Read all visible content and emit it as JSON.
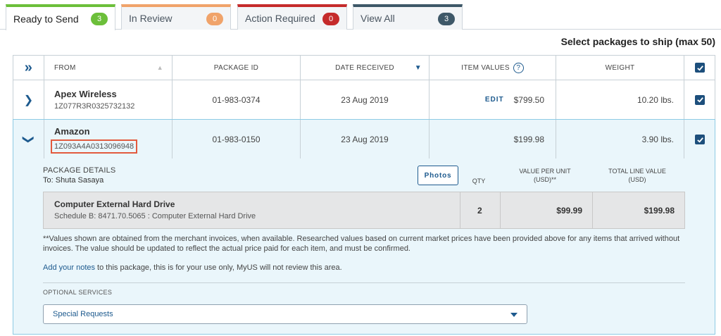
{
  "tabs": [
    {
      "label": "Ready to Send",
      "count": "3",
      "color": "#6cbf3a"
    },
    {
      "label": "In Review",
      "count": "0",
      "color": "#f0a36a"
    },
    {
      "label": "Action Required",
      "count": "0",
      "color": "#c52b2b"
    },
    {
      "label": "View All",
      "count": "3",
      "color": "#3e5868"
    }
  ],
  "select_label": "Select packages to ship (max 50)",
  "columns": {
    "expand_all": "»",
    "from": "FROM",
    "package_id": "PACKAGE ID",
    "date_received": "DATE RECEIVED",
    "item_values": "ITEM VALUES",
    "weight": "WEIGHT",
    "help": "?"
  },
  "packages": [
    {
      "from": "Apex Wireless",
      "tracking": "1Z077R3R0325732132",
      "package_id": "01-983-0374",
      "date": "23 Aug 2019",
      "edit": "EDIT",
      "value": "$799.50",
      "weight": "10.20 lbs."
    },
    {
      "from": "Amazon",
      "tracking": "1Z093A4A0313096948",
      "package_id": "01-983-0150",
      "date": "23 Aug 2019",
      "value": "$199.98",
      "weight": "3.90 lbs."
    }
  ],
  "details": {
    "title": "PACKAGE DETAILS",
    "to": "To: Shuta Sasaya",
    "photos": "Photos",
    "qty_header": "QTY",
    "value_per_unit_header_1": "VALUE PER UNIT",
    "value_per_unit_header_2": "(USD)**",
    "total_header_1": "TOTAL LINE VALUE",
    "total_header_2": "(USD)",
    "item": {
      "name": "Computer External Hard Drive",
      "schedule": "Schedule B: 8471.70.5065 : Computer External Hard Drive",
      "qty": "2",
      "unit_value": "$99.99",
      "total": "$199.98"
    },
    "note": "**Values shown are obtained from the merchant invoices, when available. Researched values based on current market prices have been provided above for any items that arrived without invoices. The value should be updated to reflect the actual price paid for each item, and must be confirmed.",
    "notes_link": "Add your notes",
    "notes_rest": " to this package, this is for your use only, MyUS will not review this area.",
    "optional_services": "OPTIONAL SERVICES",
    "special_requests": "Special Requests"
  },
  "icons": {
    "expand": "chevron-right-icon",
    "collapse": "chevron-down-icon",
    "checkbox": "checkbox-checked-icon"
  }
}
